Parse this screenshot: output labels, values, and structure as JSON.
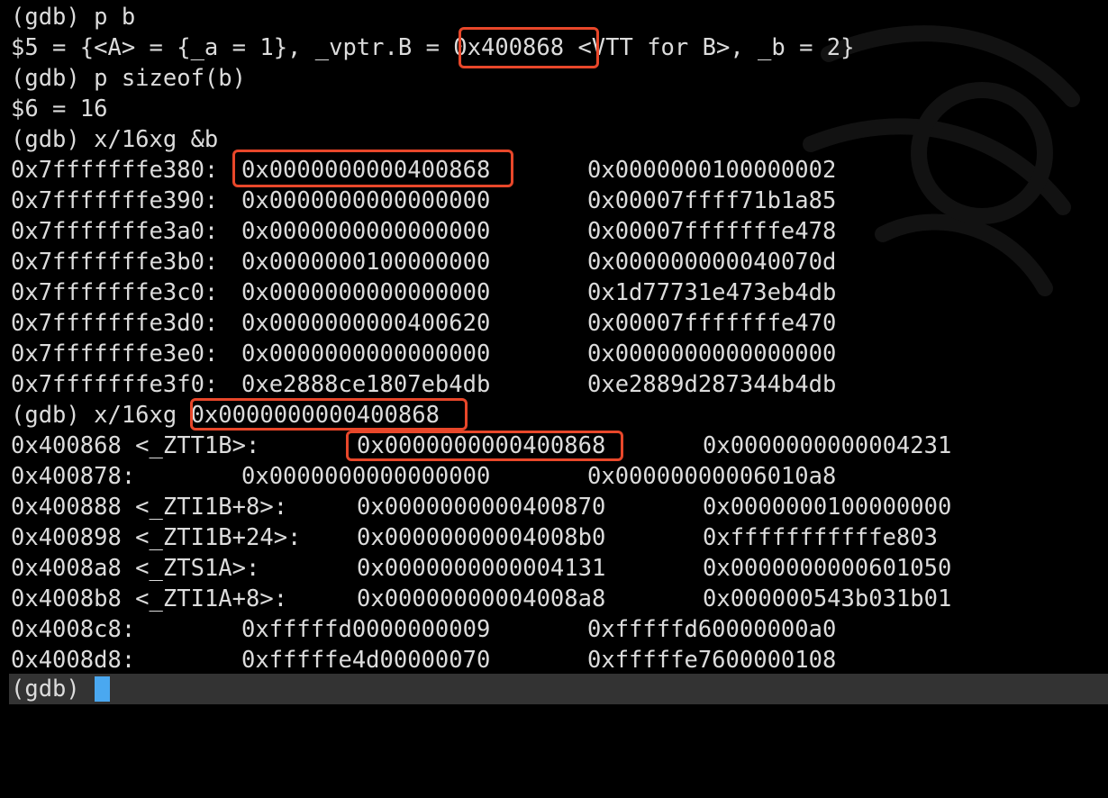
{
  "terminal": {
    "lines": [
      "(gdb) p b",
      "$5 = {<A> = {_a = 1}, _vptr.B = 0x400868 <VTT for B>, _b = 2}",
      "(gdb) p sizeof(b)",
      "$6 = 16",
      "(gdb) x/16xg &b"
    ],
    "dump1": [
      {
        "addr": "0x7fffffffe380:",
        "v1": "0x0000000000400868",
        "v2": "0x0000000100000002"
      },
      {
        "addr": "0x7fffffffe390:",
        "v1": "0x0000000000000000",
        "v2": "0x00007ffff71b1a85"
      },
      {
        "addr": "0x7fffffffe3a0:",
        "v1": "0x0000000000000000",
        "v2": "0x00007fffffffe478"
      },
      {
        "addr": "0x7fffffffe3b0:",
        "v1": "0x0000000100000000",
        "v2": "0x000000000040070d"
      },
      {
        "addr": "0x7fffffffe3c0:",
        "v1": "0x0000000000000000",
        "v2": "0x1d77731e473eb4db"
      },
      {
        "addr": "0x7fffffffe3d0:",
        "v1": "0x0000000000400620",
        "v2": "0x00007fffffffe470"
      },
      {
        "addr": "0x7fffffffe3e0:",
        "v1": "0x0000000000000000",
        "v2": "0x0000000000000000"
      },
      {
        "addr": "0x7fffffffe3f0:",
        "v1": "0xe2888ce1807eb4db",
        "v2": "0xe2889d287344b4db"
      }
    ],
    "cmd2": "(gdb) x/16xg 0x0000000000400868",
    "dump2": [
      {
        "addr": "0x400868 <_ZTT1B>:",
        "v1": "0x0000000000400868",
        "v2": "0x0000000000004231"
      },
      {
        "addr": "0x400878:",
        "v1": "0x0000000000000000",
        "v2": "0x00000000006010a8"
      },
      {
        "addr": "0x400888 <_ZTI1B+8>:",
        "v1": "0x0000000000400870",
        "v2": "0x0000000100000000"
      },
      {
        "addr": "0x400898 <_ZTI1B+24>:",
        "v1": "0x00000000004008b0",
        "v2": "0xfffffffffffe803"
      },
      {
        "addr": "0x4008a8 <_ZTS1A>:",
        "v1": "0x0000000000004131",
        "v2": "0x0000000000601050"
      },
      {
        "addr": "0x4008b8 <_ZTI1A+8>:",
        "v1": "0x00000000004008a8",
        "v2": "0x000000543b031b01"
      },
      {
        "addr": "0x4008c8:",
        "v1": "0xfffffd0000000009",
        "v2": "0xfffffd60000000a0"
      },
      {
        "addr": "0x4008d8:",
        "v1": "0xfffffe4d00000070",
        "v2": "0xfffffe7600000108"
      }
    ],
    "prompt": "(gdb) "
  },
  "colors": {
    "background": "#000000",
    "text": "#dcdcdc",
    "highlight_box": "#e8472a",
    "cursor": "#4aa8f0",
    "prompt_bar": "#333333"
  }
}
